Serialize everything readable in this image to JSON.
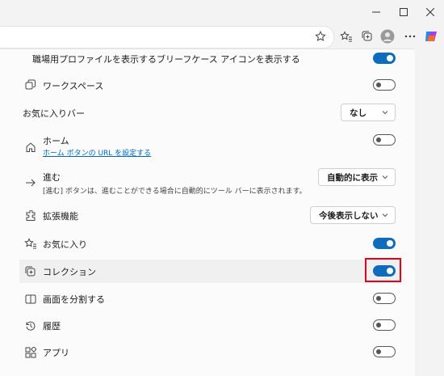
{
  "window": {
    "controls": [
      "minimize",
      "maximize",
      "close"
    ]
  },
  "toolbar": {
    "icons": [
      "star-icon",
      "favorites-icon",
      "collections-icon",
      "profile-avatar",
      "more-icon",
      "copilot-icon"
    ]
  },
  "settings": {
    "rows": [
      {
        "label": "職場用プロファイルを表示するブリーフケース アイコンを表示する",
        "control": "toggle",
        "on": true
      },
      {
        "label": "ワークスペース",
        "control": "toggle",
        "on": false
      },
      {
        "label": "お気に入りバー",
        "control": "select",
        "value": "なし"
      },
      {
        "label": "ホーム",
        "link": "ホーム ボタンの URL を設定する",
        "control": "toggle",
        "on": false
      },
      {
        "label": "進む",
        "sub": "[進む] ボタンは、進むことができる場合に自動的にツール バーに表示されます。",
        "control": "select",
        "value": "自動的に表示"
      },
      {
        "label": "拡張機能",
        "control": "select",
        "value": "今後表示しない"
      },
      {
        "label": "お気に入り",
        "control": "toggle",
        "on": true
      },
      {
        "label": "コレクション",
        "control": "toggle",
        "on": true,
        "highlighted": true
      },
      {
        "label": "画面を分割する",
        "control": "toggle",
        "on": false
      },
      {
        "label": "履歴",
        "control": "toggle",
        "on": false
      },
      {
        "label": "アプリ",
        "control": "toggle",
        "on": false
      }
    ]
  }
}
